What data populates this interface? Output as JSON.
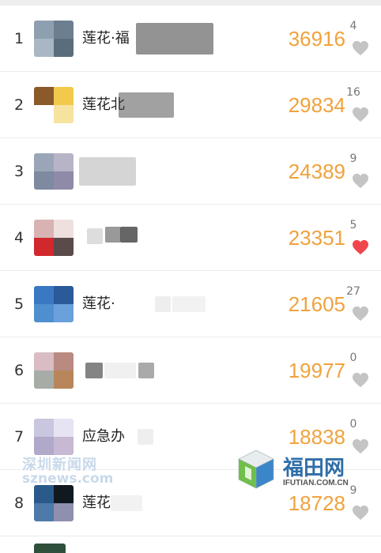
{
  "rows": [
    {
      "rank": "1",
      "name": "莲花·福",
      "steps": "36916",
      "likes": "4",
      "liked": false,
      "colors": [
        "#8ea0b0",
        "#6b7f90",
        "#a9b7c4",
        "#5a6d7c"
      ]
    },
    {
      "rank": "2",
      "name": "莲花北",
      "steps": "29834",
      "likes": "16",
      "liked": false,
      "colors": [
        "#8a5a2b",
        "#f2c94c",
        "#ffffff",
        "#f6e3a0"
      ]
    },
    {
      "rank": "3",
      "name": "",
      "steps": "24389",
      "likes": "9",
      "liked": false,
      "colors": [
        "#9aa6b8",
        "#b8b4c8",
        "#7d8aa0",
        "#8f8aa8"
      ]
    },
    {
      "rank": "4",
      "name": "",
      "steps": "23351",
      "likes": "5",
      "liked": true,
      "colors": [
        "#d9b3b3",
        "#efe0e0",
        "#d0282d",
        "#5a4a4a"
      ]
    },
    {
      "rank": "5",
      "name": "莲花·",
      "steps": "21605",
      "likes": "27",
      "liked": false,
      "colors": [
        "#3a78c2",
        "#2a5a9a",
        "#4f8fd0",
        "#6aa0dc"
      ]
    },
    {
      "rank": "6",
      "name": "",
      "steps": "19977",
      "likes": "0",
      "liked": false,
      "colors": [
        "#d9bcc4",
        "#b98a80",
        "#a8aca6",
        "#b8865a"
      ]
    },
    {
      "rank": "7",
      "name": "应急办",
      "steps": "18838",
      "likes": "0",
      "liked": false,
      "colors": [
        "#c9c6e0",
        "#e6e3f2",
        "#b0a9c9",
        "#c7b8d4"
      ]
    },
    {
      "rank": "8",
      "name": "莲花·",
      "steps": "18728",
      "likes": "9",
      "liked": false,
      "colors": [
        "#2a5a8a",
        "#101820",
        "#4d7aa8",
        "#8f8fb0"
      ]
    }
  ],
  "watermark": {
    "line1": "深圳新闻网",
    "line2": "sznews.com"
  },
  "logo": {
    "title": "福田网",
    "sub": "IFUTIAN.COM.CN"
  },
  "colors": {
    "steps": "#f0a23d",
    "heart_on": "#f0464b",
    "heart_off": "#c4c4c4"
  }
}
